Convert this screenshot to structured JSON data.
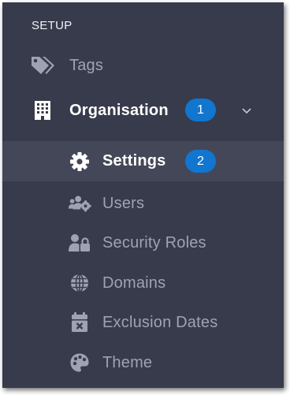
{
  "sidebar": {
    "section_label": "SETUP",
    "items": [
      {
        "label": "Tags",
        "icon": "tags-icon"
      },
      {
        "label": "Organisation",
        "icon": "building-icon",
        "badge": "1",
        "expanded": true
      },
      {
        "label": "Settings",
        "icon": "gear-icon",
        "badge": "2",
        "active": true
      },
      {
        "label": "Users",
        "icon": "users-cog-icon"
      },
      {
        "label": "Security Roles",
        "icon": "user-lock-icon"
      },
      {
        "label": "Domains",
        "icon": "globe-icon"
      },
      {
        "label": "Exclusion Dates",
        "icon": "calendar-times-icon"
      },
      {
        "label": "Theme",
        "icon": "palette-icon"
      }
    ]
  },
  "colors": {
    "background": "#383b4c",
    "active_row": "#444758",
    "badge": "#1176cf",
    "muted_text": "#9fa3b1",
    "active_text": "#ffffff"
  }
}
